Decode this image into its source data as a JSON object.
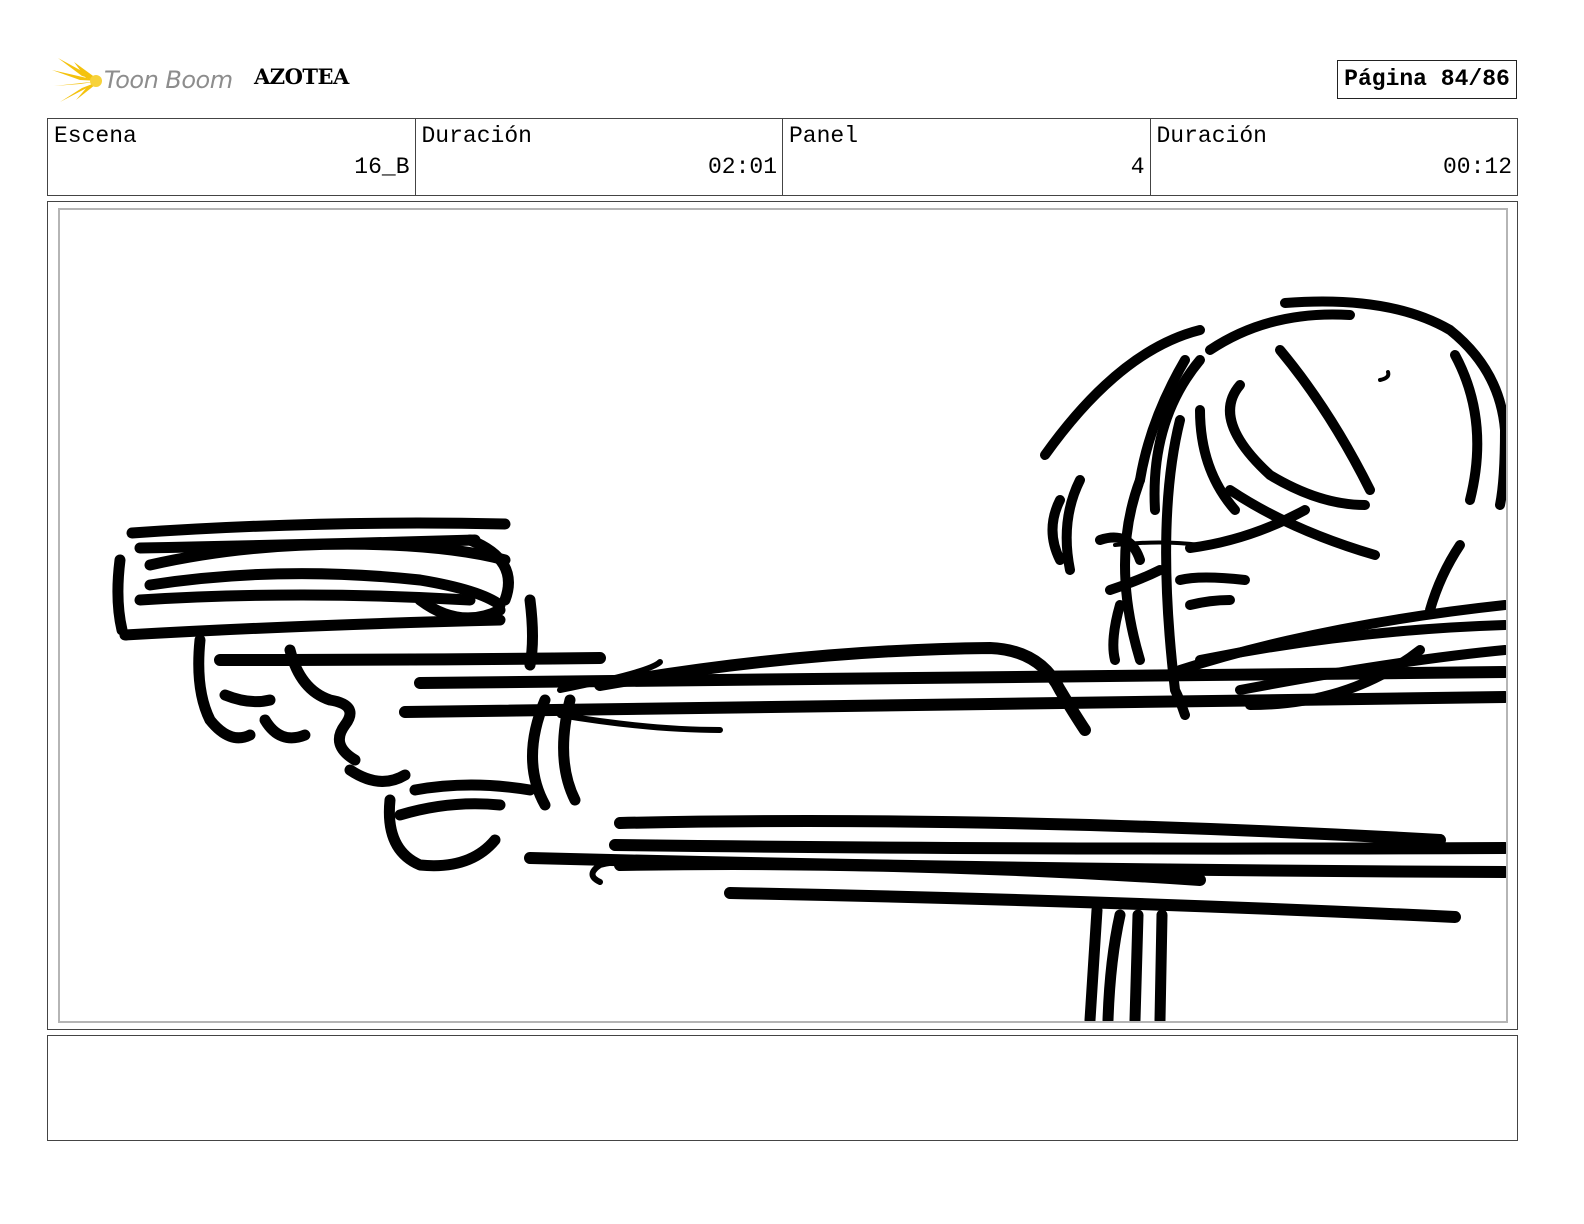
{
  "header": {
    "logo_text": "Toon Boom",
    "project_title": "AZOTEA",
    "page_label": "Página 84/86"
  },
  "info": {
    "scene_label": "Escena",
    "scene_value": "16_B",
    "scene_duration_label": "Duración",
    "scene_duration_value": "02:01",
    "panel_label": "Panel",
    "panel_value": "4",
    "panel_duration_label": "Duración",
    "panel_duration_value": "00:12"
  },
  "notes": {
    "text": ""
  },
  "colors": {
    "logo_accent": "#f4c20d",
    "logo_text": "#8d8d8d",
    "ink": "#000000",
    "frame": "#b5b5b5"
  }
}
